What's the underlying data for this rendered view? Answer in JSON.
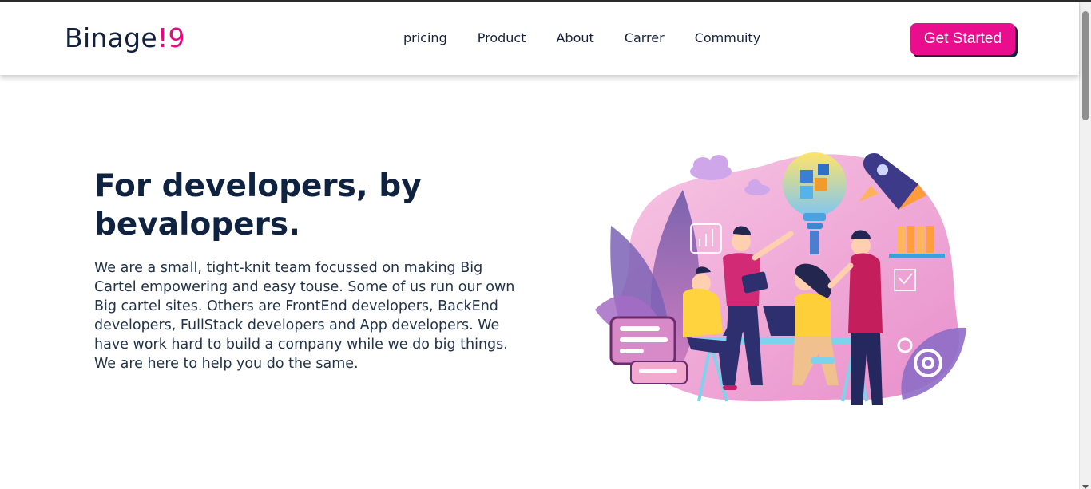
{
  "header": {
    "logo_text": "Binage",
    "logo_accent": "!9",
    "nav": [
      "pricing",
      "Product",
      "About",
      "Carrer",
      "Commuity"
    ],
    "cta_label": "Get Started"
  },
  "hero": {
    "title": "For developers, by bevalopers.",
    "description": "We are a small, tight-knit team focussed on making Big Cartel empowering and easy touse. Some of us run our own Big cartel sites. Others are FrontEnd developers, BackEnd developers, FullStack developers and App developers. We have work hard to build a company while we do big things. We are here to help you do the same."
  },
  "colors": {
    "accent": "#ea0d8d",
    "text": "#14213d"
  }
}
